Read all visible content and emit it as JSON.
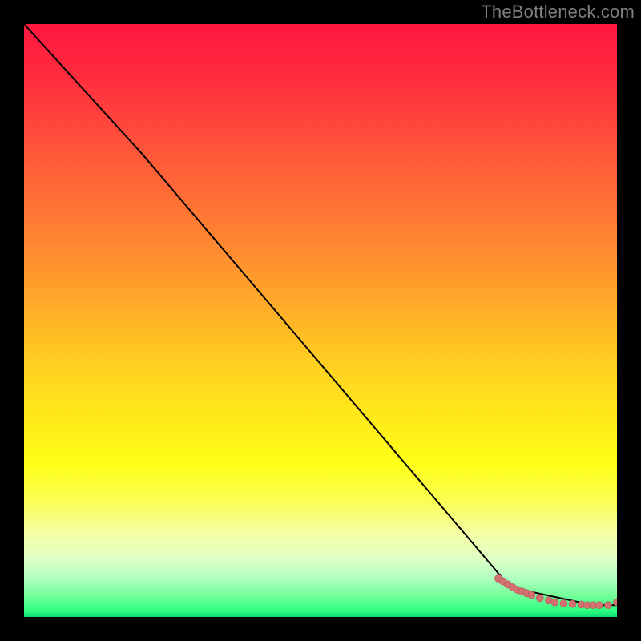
{
  "watermark": "TheBottleneck.com",
  "chart_data": {
    "type": "line",
    "title": "",
    "xlabel": "",
    "ylabel": "",
    "xlim": [
      0,
      100
    ],
    "ylim": [
      0,
      100
    ],
    "grid": false,
    "series": [
      {
        "name": "curve",
        "kind": "line",
        "x": [
          0,
          20,
          82,
          96,
          100
        ],
        "y": [
          100,
          78,
          5,
          2,
          2
        ]
      },
      {
        "name": "bottom-dots",
        "kind": "scatter",
        "x": [
          80,
          80.8,
          81.6,
          82.4,
          83.2,
          84,
          84.8,
          85.6,
          87,
          88.5,
          89.5,
          91,
          92.5,
          94,
          95,
          96,
          97,
          98.5,
          100
        ],
        "y": [
          6.5,
          6,
          5.5,
          5,
          4.6,
          4.3,
          4,
          3.7,
          3.2,
          2.8,
          2.5,
          2.3,
          2.2,
          2.1,
          2.0,
          2.0,
          2.0,
          2.0,
          2.5
        ]
      }
    ]
  },
  "colors": {
    "curve": "#000000",
    "dot_fill": "#d37070",
    "dot_stroke": "#b35a5a"
  }
}
